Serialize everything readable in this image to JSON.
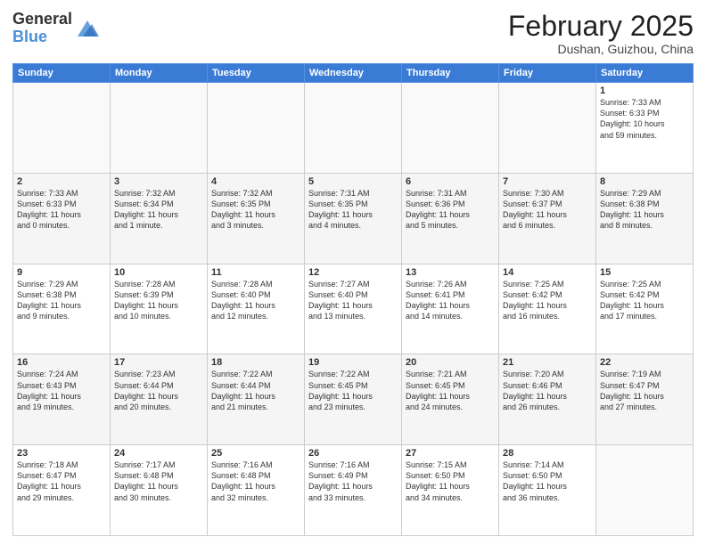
{
  "header": {
    "logo_general": "General",
    "logo_blue": "Blue",
    "month_title": "February 2025",
    "location": "Dushan, Guizhou, China"
  },
  "days_of_week": [
    "Sunday",
    "Monday",
    "Tuesday",
    "Wednesday",
    "Thursday",
    "Friday",
    "Saturday"
  ],
  "weeks": [
    [
      {
        "day": "",
        "info": ""
      },
      {
        "day": "",
        "info": ""
      },
      {
        "day": "",
        "info": ""
      },
      {
        "day": "",
        "info": ""
      },
      {
        "day": "",
        "info": ""
      },
      {
        "day": "",
        "info": ""
      },
      {
        "day": "1",
        "info": "Sunrise: 7:33 AM\nSunset: 6:33 PM\nDaylight: 10 hours\nand 59 minutes."
      }
    ],
    [
      {
        "day": "2",
        "info": "Sunrise: 7:33 AM\nSunset: 6:33 PM\nDaylight: 11 hours\nand 0 minutes."
      },
      {
        "day": "3",
        "info": "Sunrise: 7:32 AM\nSunset: 6:34 PM\nDaylight: 11 hours\nand 1 minute."
      },
      {
        "day": "4",
        "info": "Sunrise: 7:32 AM\nSunset: 6:35 PM\nDaylight: 11 hours\nand 3 minutes."
      },
      {
        "day": "5",
        "info": "Sunrise: 7:31 AM\nSunset: 6:35 PM\nDaylight: 11 hours\nand 4 minutes."
      },
      {
        "day": "6",
        "info": "Sunrise: 7:31 AM\nSunset: 6:36 PM\nDaylight: 11 hours\nand 5 minutes."
      },
      {
        "day": "7",
        "info": "Sunrise: 7:30 AM\nSunset: 6:37 PM\nDaylight: 11 hours\nand 6 minutes."
      },
      {
        "day": "8",
        "info": "Sunrise: 7:29 AM\nSunset: 6:38 PM\nDaylight: 11 hours\nand 8 minutes."
      }
    ],
    [
      {
        "day": "9",
        "info": "Sunrise: 7:29 AM\nSunset: 6:38 PM\nDaylight: 11 hours\nand 9 minutes."
      },
      {
        "day": "10",
        "info": "Sunrise: 7:28 AM\nSunset: 6:39 PM\nDaylight: 11 hours\nand 10 minutes."
      },
      {
        "day": "11",
        "info": "Sunrise: 7:28 AM\nSunset: 6:40 PM\nDaylight: 11 hours\nand 12 minutes."
      },
      {
        "day": "12",
        "info": "Sunrise: 7:27 AM\nSunset: 6:40 PM\nDaylight: 11 hours\nand 13 minutes."
      },
      {
        "day": "13",
        "info": "Sunrise: 7:26 AM\nSunset: 6:41 PM\nDaylight: 11 hours\nand 14 minutes."
      },
      {
        "day": "14",
        "info": "Sunrise: 7:25 AM\nSunset: 6:42 PM\nDaylight: 11 hours\nand 16 minutes."
      },
      {
        "day": "15",
        "info": "Sunrise: 7:25 AM\nSunset: 6:42 PM\nDaylight: 11 hours\nand 17 minutes."
      }
    ],
    [
      {
        "day": "16",
        "info": "Sunrise: 7:24 AM\nSunset: 6:43 PM\nDaylight: 11 hours\nand 19 minutes."
      },
      {
        "day": "17",
        "info": "Sunrise: 7:23 AM\nSunset: 6:44 PM\nDaylight: 11 hours\nand 20 minutes."
      },
      {
        "day": "18",
        "info": "Sunrise: 7:22 AM\nSunset: 6:44 PM\nDaylight: 11 hours\nand 21 minutes."
      },
      {
        "day": "19",
        "info": "Sunrise: 7:22 AM\nSunset: 6:45 PM\nDaylight: 11 hours\nand 23 minutes."
      },
      {
        "day": "20",
        "info": "Sunrise: 7:21 AM\nSunset: 6:45 PM\nDaylight: 11 hours\nand 24 minutes."
      },
      {
        "day": "21",
        "info": "Sunrise: 7:20 AM\nSunset: 6:46 PM\nDaylight: 11 hours\nand 26 minutes."
      },
      {
        "day": "22",
        "info": "Sunrise: 7:19 AM\nSunset: 6:47 PM\nDaylight: 11 hours\nand 27 minutes."
      }
    ],
    [
      {
        "day": "23",
        "info": "Sunrise: 7:18 AM\nSunset: 6:47 PM\nDaylight: 11 hours\nand 29 minutes."
      },
      {
        "day": "24",
        "info": "Sunrise: 7:17 AM\nSunset: 6:48 PM\nDaylight: 11 hours\nand 30 minutes."
      },
      {
        "day": "25",
        "info": "Sunrise: 7:16 AM\nSunset: 6:48 PM\nDaylight: 11 hours\nand 32 minutes."
      },
      {
        "day": "26",
        "info": "Sunrise: 7:16 AM\nSunset: 6:49 PM\nDaylight: 11 hours\nand 33 minutes."
      },
      {
        "day": "27",
        "info": "Sunrise: 7:15 AM\nSunset: 6:50 PM\nDaylight: 11 hours\nand 34 minutes."
      },
      {
        "day": "28",
        "info": "Sunrise: 7:14 AM\nSunset: 6:50 PM\nDaylight: 11 hours\nand 36 minutes."
      },
      {
        "day": "",
        "info": ""
      }
    ]
  ]
}
